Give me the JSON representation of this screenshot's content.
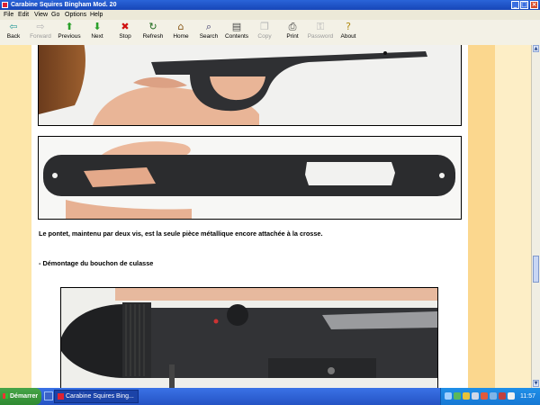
{
  "window": {
    "title": "Carabine Squires Bingham Mod. 20",
    "buttons": [
      "_",
      "□",
      "×"
    ]
  },
  "menu": [
    "File",
    "Edit",
    "View",
    "Go",
    "Options",
    "Help"
  ],
  "toolbar": [
    {
      "label": "Back",
      "icon": "back-arrow-icon",
      "glyph": "⇦",
      "color": "#2a9a9a",
      "enabled": true
    },
    {
      "label": "Forward",
      "icon": "forward-arrow-icon",
      "glyph": "⇨",
      "color": "#9a9a9a",
      "enabled": false
    },
    {
      "label": "Previous",
      "icon": "up-arrow-icon",
      "glyph": "⬆",
      "color": "#2aa02a",
      "enabled": true
    },
    {
      "label": "Next",
      "icon": "down-arrow-icon",
      "glyph": "⬇",
      "color": "#2aa02a",
      "enabled": true
    },
    {
      "label": "Stop",
      "icon": "stop-icon",
      "glyph": "✖",
      "color": "#d01010",
      "enabled": true
    },
    {
      "label": "Refresh",
      "icon": "refresh-icon",
      "glyph": "↻",
      "color": "#1e6a1e",
      "enabled": true
    },
    {
      "label": "Home",
      "icon": "home-icon",
      "glyph": "⌂",
      "color": "#8a5a1a",
      "enabled": true
    },
    {
      "label": "Search",
      "icon": "search-icon",
      "glyph": "⌕",
      "color": "#3a3a6a",
      "enabled": true
    },
    {
      "label": "Contents",
      "icon": "contents-icon",
      "glyph": "▤",
      "color": "#4a4a4a",
      "enabled": true
    },
    {
      "label": "Copy",
      "icon": "copy-icon",
      "glyph": "❐",
      "color": "#9a9a9a",
      "enabled": false
    },
    {
      "label": "Print",
      "icon": "print-icon",
      "glyph": "⎙",
      "color": "#3a3a3a",
      "enabled": true
    },
    {
      "label": "Password",
      "icon": "password-key-icon",
      "glyph": "⚿",
      "color": "#9a9a9a",
      "enabled": false
    },
    {
      "label": "About",
      "icon": "about-question-icon",
      "glyph": "?",
      "color": "#b08a10",
      "enabled": true
    }
  ],
  "page": {
    "caption_1": "Le pontet, maintenu par deux vis, est la seule pièce métallique encore attachée à la crosse.",
    "caption_2": "- Démontage du bouchon de culasse"
  },
  "taskbar": {
    "start_label": "Démarrer",
    "task_label": "Carabine Squires Bing...",
    "clock": "11:57"
  }
}
